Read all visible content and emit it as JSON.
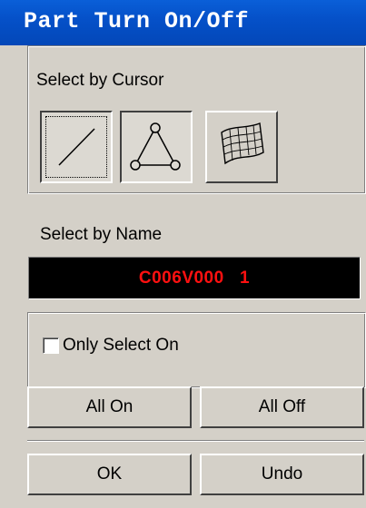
{
  "window": {
    "title": "Part Turn On/Off"
  },
  "select_by_cursor": {
    "label": "Select by Cursor",
    "tools": [
      {
        "name": "line-tool-icon",
        "pressed": true
      },
      {
        "name": "triangle-nodes-tool-icon",
        "pressed": true
      },
      {
        "name": "mesh-surface-tool-icon",
        "pressed": false
      }
    ]
  },
  "select_by_name": {
    "label": "Select by Name",
    "value": "C006V000   1"
  },
  "options": {
    "only_select_on_label": "Only Select On",
    "only_select_on_checked": false
  },
  "buttons": {
    "all_on": "All On",
    "all_off": "All Off",
    "ok": "OK",
    "undo": "Undo"
  },
  "colors": {
    "title_bar": "#0551c9",
    "field_bg": "#000000",
    "field_text": "#ff1010",
    "panel_bg": "#d4d0c8"
  }
}
